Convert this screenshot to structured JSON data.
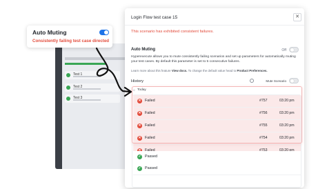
{
  "auto_muting_card": {
    "title": "Auto Muting",
    "subtitle": "Consistently failing test case directed",
    "toggle_state": "on"
  },
  "background_app": {
    "rows": [
      {
        "label": "Test 1"
      },
      {
        "label": "Test 2"
      },
      {
        "label": "Test 3"
      }
    ]
  },
  "panel": {
    "title": "Login Flow test case 15",
    "close_label": "✕",
    "alert": "This scenario has exhibited consistent failures.",
    "auto_muting": {
      "heading": "Auto Muting",
      "state_label": "Off",
      "description": "Hyperexecute allows you to mute consistently failing scenarios and set up parameters for automatically muting your test cases. By default this parameter is set to 5 consecutive failures.",
      "learn_prefix": "Learn more about this feature ",
      "learn_link": "View docs.",
      "learn_mid": " To change the default value head to ",
      "learn_settings": "Product Preferences."
    },
    "history": {
      "heading": "History",
      "mute_label": "Mute Scenario",
      "mute_state": "Off",
      "group_label": "Today"
    },
    "rows": [
      {
        "status": "Failed",
        "run": "#757",
        "time": "03:20 pm"
      },
      {
        "status": "Failed",
        "run": "#756",
        "time": "03:20 pm"
      },
      {
        "status": "Failed",
        "run": "#755",
        "time": "03:20 pm"
      },
      {
        "status": "Failed",
        "run": "#754",
        "time": "03:20 pm"
      },
      {
        "status": "Failed",
        "run": "#753",
        "time": "03:20 pm"
      },
      {
        "status": "Passed",
        "run": "",
        "time": ""
      },
      {
        "status": "Passed",
        "run": "",
        "time": ""
      }
    ]
  },
  "colors": {
    "accent": "#1e74e8",
    "failed": "#e24b3b",
    "passed": "#3aa655",
    "failed_bg": "#fbe9e9"
  },
  "icons": {
    "close": "close-icon",
    "failed": "x-circle-icon",
    "passed": "check-circle-icon",
    "mute": "mute-icon",
    "today": "sun-icon"
  }
}
